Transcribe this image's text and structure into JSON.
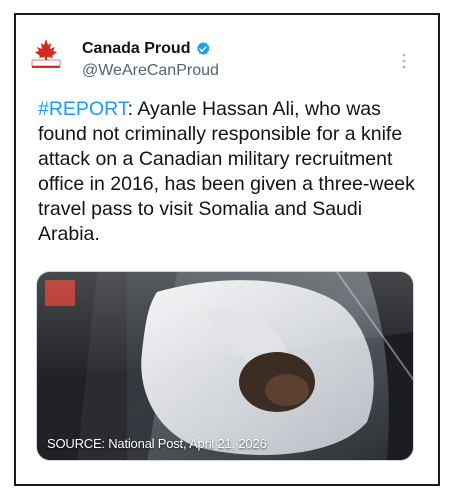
{
  "account": {
    "name": "Canada Proud",
    "handle": "@WeAreCanProud",
    "avatar_icon": "maple-leaf-logo-icon",
    "avatar_logo_text": "CANADA PROUD",
    "verified_icon": "verified-badge-icon",
    "verified_color": "#1d9bf0"
  },
  "more_icon": "more-options-icon",
  "tweet": {
    "hashtag": "#REPORT",
    "text": ": Ayanle Hassan Ali, who was found not criminally responsible for a knife attack on a Canadian military recruitment office in 2016, has been given a three-week travel pass to visit Somalia and Saudi Arabia.",
    "hashtag_color": "#1d9bf0"
  },
  "media": {
    "caption": "SOURCE: National Post, April 21, 2026",
    "description_icon": "photo-image"
  }
}
